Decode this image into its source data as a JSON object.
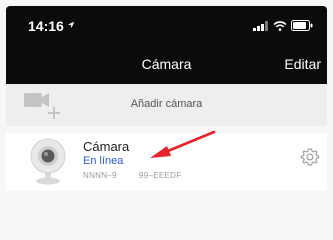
{
  "status_bar": {
    "time": "14:16",
    "icons": [
      "location-arrow-icon",
      "signal-icon",
      "wifi-icon",
      "battery-icon"
    ]
  },
  "nav": {
    "title": "Cámara",
    "action_label": "Editar"
  },
  "add_camera": {
    "icon": "add-camera-icon",
    "label": "Añadir cámara"
  },
  "device": {
    "icon": "webcam-icon",
    "name": "Cámara",
    "status": "En línea",
    "id": "NNNN–9",
    "code": "99–EEEDF",
    "settings_icon": "gear-icon"
  },
  "annotation": {
    "icon": "red-arrow-icon",
    "color": "#e8232a"
  },
  "colors": {
    "header_bg": "#0b0b0b",
    "status_online": "#2a5bd7"
  }
}
